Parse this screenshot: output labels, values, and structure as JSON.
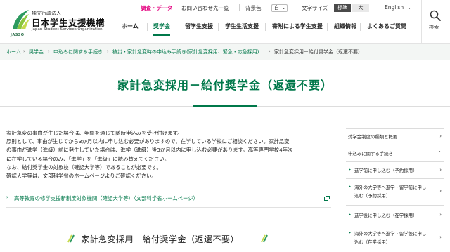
{
  "header": {
    "logo": {
      "org_type": "独立行政法人",
      "name": "日本学生支援機構",
      "name_en": "Japan Student Services Organization",
      "mark": "JASSO"
    },
    "utility": {
      "research_data": "調査・データ",
      "contact": "お問い合わせ先一覧",
      "bg_color_label": "背景色",
      "bg_color_value": "白",
      "text_size_label": "文字サイズ",
      "size_standard": "標準",
      "size_large": "大",
      "language": "English"
    },
    "nav": [
      "ホーム",
      "奨学金",
      "留学生支援",
      "学生生活支援",
      "寄附による学生支援",
      "組織情報",
      "よくあるご質問"
    ],
    "nav_current": "奨学金",
    "search_label": "検索"
  },
  "breadcrumb": [
    "ホーム",
    "奨学金",
    "申込みに関する手続き",
    "被災・家計急変時の申込み手続き(家計急変採用、緊急・応急採用)",
    "家計急変採用－給付奨学金（返還不要）"
  ],
  "page_title": "家計急変採用－給付奨学金（返還不要）",
  "body": {
    "lines": [
      "家計急変の事由が生じた場合は、年間を通じて随時申込みを受け付けます。",
      "原則として、事由が生じてから3か月以内に申し込む必要がありますので、在学している学校にご相談ください。家計急変",
      "の事由が進学（進級）前に発生していた場合は、進学（進級）後3か月以内に申し込む必要があります。高等専門学校4年次",
      "に在学している場合のみ、「進学」を「進級」に読み替えてください。",
      "なお、給付奨学金の対象校（確認大学等）であることが必要です。",
      "確認大学等は、文部科学省のホームページよりご確認ください。"
    ],
    "external_link": "高等教育の修学支援新制度対象機関（確認大学等）（文部科学省ホームページ）",
    "sub_heading": "家計急変採用－給付奨学金（返還不要）"
  },
  "sidebar": {
    "items": [
      {
        "label": "奨学金制度の種類と概要",
        "chevron": "›"
      },
      {
        "label": "申込みに関する手続き",
        "chevron": "⌃"
      },
      {
        "label": "進学前に申し込む（予約採用）",
        "chevron": "›"
      },
      {
        "label": "海外の大学等へ進学・留学前に申し",
        "label2": "込む（予約採用）",
        "chevron": "›"
      },
      {
        "label": "進学後に申し込む（在学採用）",
        "chevron": "›"
      },
      {
        "label": "海外の大学等へ進学・留学後に申し",
        "label2": "込む（在学採用）",
        "chevron": "›"
      }
    ]
  },
  "colors": {
    "brand_green": "#00784a",
    "active_pink": "#e4007f"
  }
}
